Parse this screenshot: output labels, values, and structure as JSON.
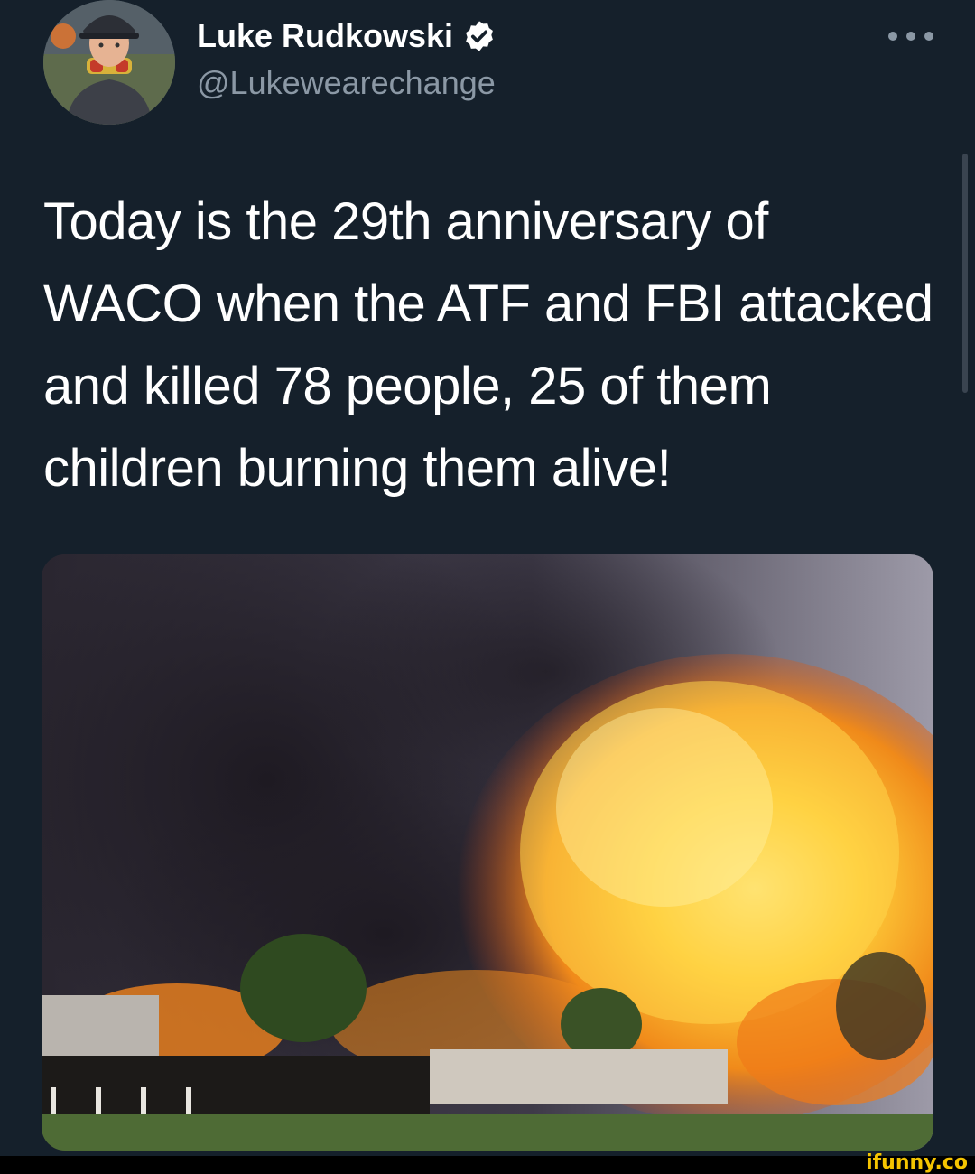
{
  "tweet": {
    "author": {
      "display_name": "Luke Rudkowski",
      "handle": "@Lukewearechange",
      "verified": true
    },
    "text": "Today is the 29th anniversary of WACO when the ATF and FBI attacked and killed 78 people, 25 of them children burning them alive!",
    "media": {
      "type": "photo"
    }
  },
  "watermark": "ifunny.co",
  "icons": {
    "verified": "verified-badge-icon",
    "more": "more-options-icon"
  },
  "colors": {
    "background": "#15202b",
    "secondary_text": "#8b98a5",
    "watermark": "#f5c400"
  }
}
